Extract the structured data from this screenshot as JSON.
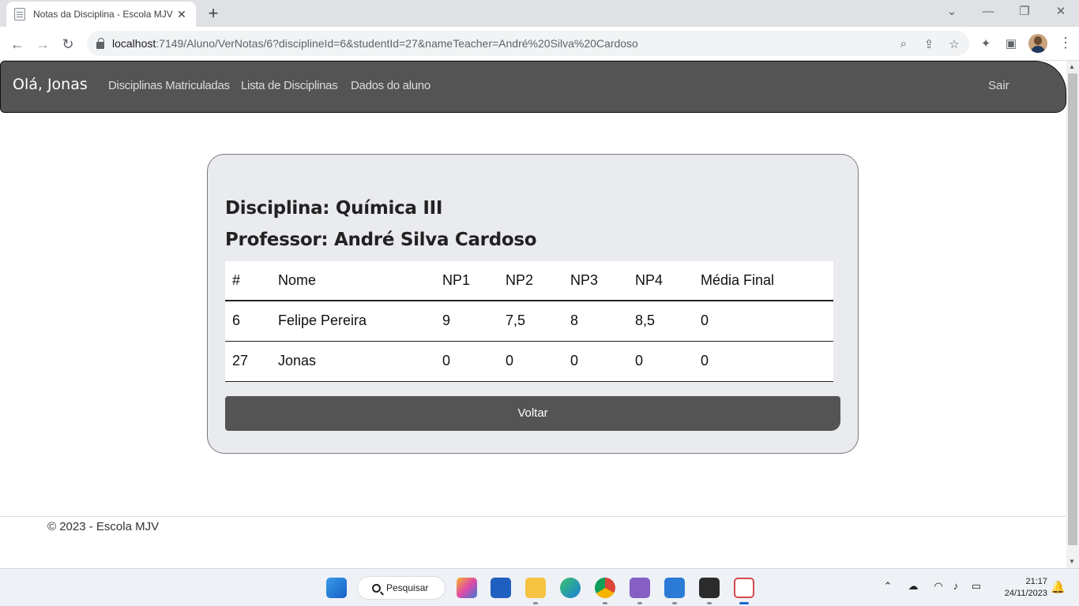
{
  "browser": {
    "tab_title": "Notas da Disciplina - Escola MJV",
    "tab_close": "✕",
    "new_tab": "+",
    "url_host": "localhost",
    "url_path": ":7149/Aluno/VerNotas/6?disciplineId=6&studentId=27&nameTeacher=André%20Silva%20Cardoso",
    "icons": [
      "back-icon",
      "forward-icon",
      "reload-icon",
      "lock-icon",
      "zoom-icon",
      "share-icon",
      "star-icon",
      "extensions-icon",
      "side-panel-icon",
      "profile-avatar",
      "menu-kebab-icon",
      "minimize-icon",
      "restore-icon",
      "close-window-icon",
      "tab-search-icon"
    ]
  },
  "site_nav": {
    "brand": "Olá, Jonas",
    "links": [
      "Disciplinas Matriculadas",
      "Lista de Disciplinas",
      "Dados do aluno"
    ],
    "logout": "Sair",
    "bg_color": "#545454"
  },
  "card": {
    "discipline_heading": "Disciplina: Química III",
    "teacher_heading": "Professor: André Silva Cardoso",
    "table": {
      "headers": [
        "#",
        "Nome",
        "NP1",
        "NP2",
        "NP3",
        "NP4",
        "Média Final"
      ],
      "rows": [
        [
          "6",
          "Felipe Pereira",
          "9",
          "7,5",
          "8",
          "8,5",
          "0"
        ],
        [
          "27",
          "Jonas",
          "0",
          "0",
          "0",
          "0",
          "0"
        ]
      ]
    },
    "back_button": "Voltar"
  },
  "footer": {
    "text": "© 2023 - Escola MJV"
  },
  "taskbar": {
    "search_label": "Pesquisar",
    "time": "21:17",
    "date": "24/11/2023",
    "apps": [
      "windows-start-icon",
      "copilot-icon",
      "store-icon",
      "file-explorer-icon",
      "edge-icon",
      "chrome-icon",
      "visual-studio-icon",
      "notepad-icon",
      "terminal-icon",
      "snipping-tool-icon"
    ],
    "tray": [
      "chevron-up-icon",
      "onedrive-icon",
      "wifi-icon",
      "volume-icon",
      "battery-icon",
      "notification-bell-icon"
    ]
  }
}
